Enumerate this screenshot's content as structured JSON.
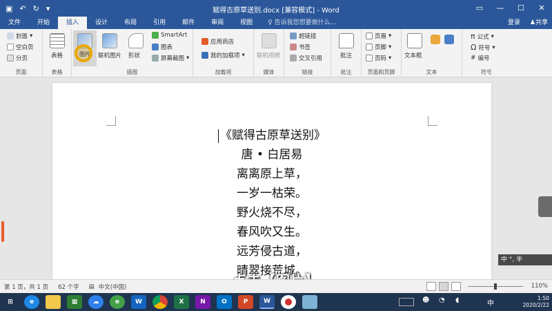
{
  "titlebar": {
    "doc_title": "赋得古原草送别.docx [兼容模式] - Word",
    "qat_icons": [
      "save-icon",
      "undo-icon",
      "redo-icon",
      "customize-icon"
    ],
    "controls": [
      "ribbon-display-icon",
      "minimize-icon",
      "maximize-icon",
      "close-icon"
    ]
  },
  "tabs": {
    "items": [
      "文件",
      "开始",
      "插入",
      "设计",
      "布局",
      "引用",
      "邮件",
      "审阅",
      "视图"
    ],
    "active": "插入",
    "tell_me": "告诉我您想要做什么...",
    "login": "登录",
    "share": "共享"
  },
  "ribbon": {
    "pages": {
      "items": [
        "封面",
        "空白页",
        "分页"
      ],
      "label": "页面"
    },
    "tables": {
      "button": "表格",
      "label": "表格"
    },
    "illustrations": {
      "picture_button": "图片",
      "online_picture": "联机图片",
      "shapes": "形状",
      "smartart": "SmartArt",
      "chart": "图表",
      "screenshot": "屏幕截图",
      "label": "插图"
    },
    "addins": {
      "store": "应用商店",
      "my_addins": "我的加载项",
      "label": "加载项"
    },
    "media": {
      "online_video": "联机视频",
      "label": "媒体"
    },
    "links": {
      "items": [
        "超链接",
        "书签",
        "交叉引用"
      ],
      "label": "链接"
    },
    "comments": {
      "button": "批注",
      "label": "批注"
    },
    "header_footer": {
      "items": [
        "页眉",
        "页脚",
        "页码"
      ],
      "label": "页眉和页脚"
    },
    "text": {
      "textbox": "文本框",
      "label": "文本"
    },
    "symbols": {
      "items": [
        "公式",
        "符号",
        "编号"
      ],
      "label": "符号"
    }
  },
  "document": {
    "lines": [
      "《赋得古原草送别》",
      "唐 • 白居易",
      "离离原上草，",
      "一岁一枯荣。",
      "野火烧不尽，",
      "春风吹又生。",
      "远芳侵古道，",
      "晴翠接荒城。"
    ]
  },
  "overlay": {
    "subtitle": "点击【图片】",
    "ime": "中 °, 半"
  },
  "statusbar": {
    "page_info": "第 1 页，共 1 页",
    "word_count": "62 个字",
    "language": "中文(中国)",
    "zoom": "110%"
  },
  "taskbar": {
    "apps": [
      "windows-start-icon",
      "edge-icon",
      "file-explorer-icon",
      "store-icon",
      "baidu-netdisk-icon",
      "ie-icon",
      "wps-icon",
      "chrome-icon",
      "excel-icon",
      "onenote-icon",
      "outlook-icon",
      "powerpoint-icon",
      "word-icon",
      "record-icon",
      "folder-icon"
    ],
    "time": "1:50",
    "date": "2020/2/22",
    "ime_indicator": "中"
  },
  "colors": {
    "word_blue": "#2b579a",
    "ribbon_bg": "#f3f3f3",
    "taskbar": "#1f3450",
    "highlight_circle": "#e8a800"
  }
}
